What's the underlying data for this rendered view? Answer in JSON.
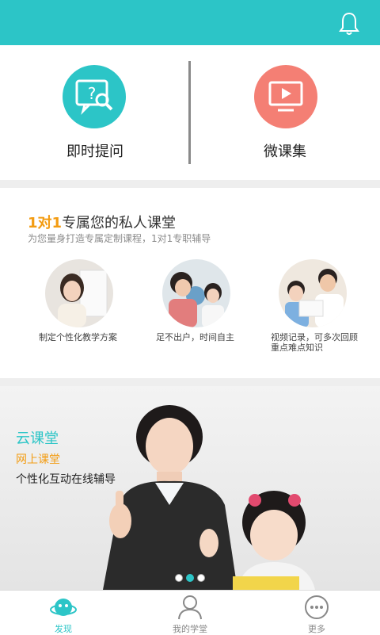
{
  "header": {
    "notification_icon": "bell-icon",
    "bar_color": "#2cc5c7"
  },
  "quick_actions": [
    {
      "label": "即时提问",
      "icon": "question-screen-icon",
      "color": "#2cc5c7"
    },
    {
      "label": "微课集",
      "icon": "video-screen-icon",
      "color": "#f47f74"
    }
  ],
  "one_to_one": {
    "title_highlight": "1对1",
    "title_rest": "专属您的私人课堂",
    "subtitle": "为您量身打造专属定制课程，1对1专职辅导",
    "features": [
      {
        "caption": "制定个性化教学方案"
      },
      {
        "caption": "足不出户，时间自主"
      },
      {
        "caption": "视频记录，可多次回顾重点难点知识"
      }
    ]
  },
  "banner": {
    "title": "云课堂",
    "subtitle": "网上课堂",
    "tagline": "个性化互动在线辅导",
    "slides_total": 3,
    "slide_active": 1
  },
  "tabs": [
    {
      "label": "发现",
      "icon": "planet-icon",
      "active": true
    },
    {
      "label": "我的学堂",
      "icon": "user-icon",
      "active": false
    },
    {
      "label": "更多",
      "icon": "more-dots-icon",
      "active": false
    }
  ]
}
